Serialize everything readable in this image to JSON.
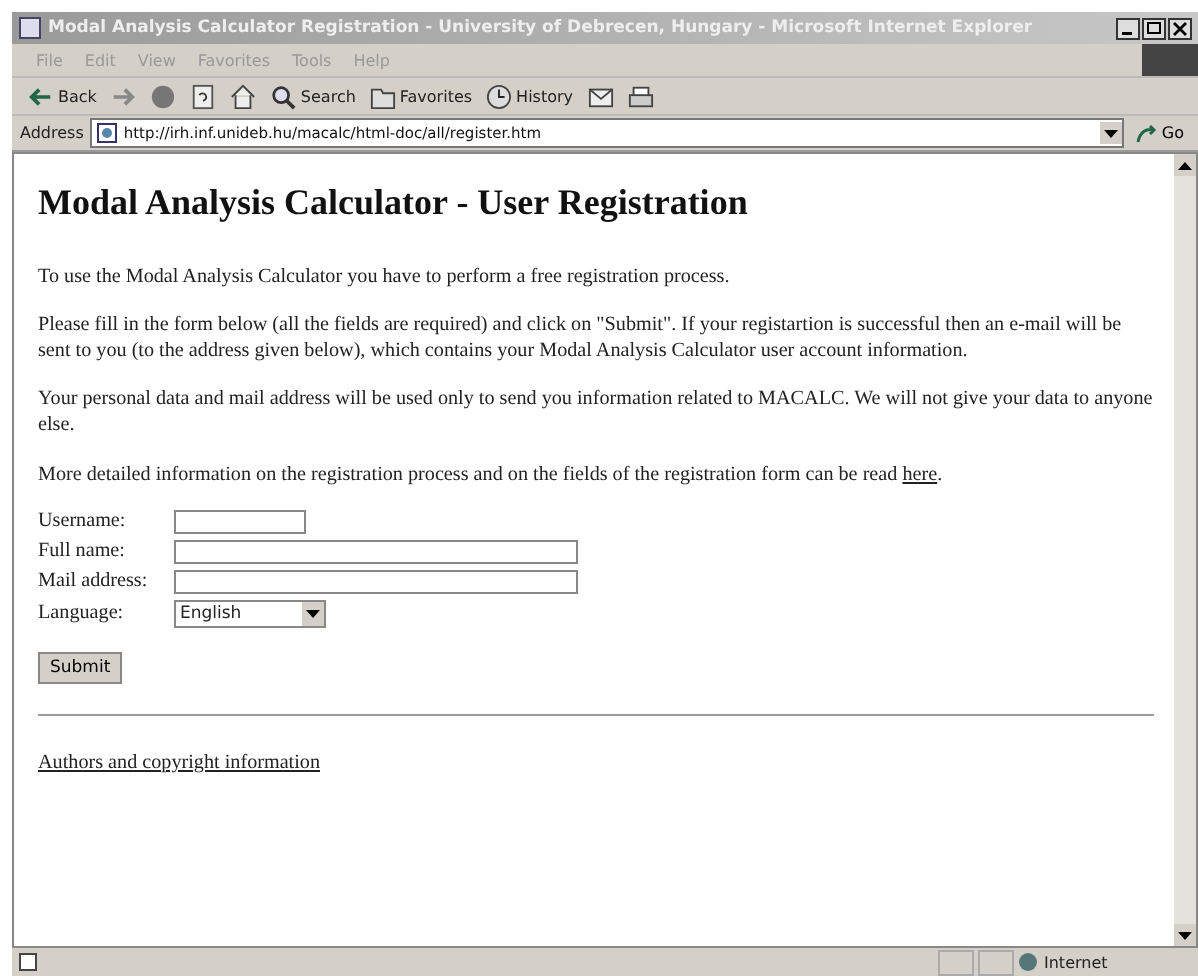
{
  "window": {
    "title": "Modal Analysis Calculator Registration - University of Debrecen, Hungary - Microsoft Internet Explorer"
  },
  "menu": [
    "File",
    "Edit",
    "View",
    "Favorites",
    "Tools",
    "Help"
  ],
  "toolbar": [
    {
      "kind": "back",
      "label": "Back"
    },
    {
      "kind": "forward"
    },
    {
      "kind": "stop"
    },
    {
      "kind": "refresh"
    },
    {
      "kind": "home"
    },
    {
      "kind": "search",
      "label": "Search"
    },
    {
      "kind": "favorites",
      "label": "Favorites"
    },
    {
      "kind": "history",
      "label": "History"
    },
    {
      "kind": "mail"
    },
    {
      "kind": "print"
    }
  ],
  "address": {
    "label": "Address",
    "value": "http://irh.inf.unideb.hu/macalc/html-doc/all/register.htm",
    "go": "Go"
  },
  "page": {
    "heading": "Modal Analysis Calculator - User Registration",
    "paragraphs": [
      "To use the Modal Analysis Calculator you have to perform a free registration process.",
      "Please fill in the form below (all the fields are required) and click on \"Submit\". If your registartion is successful then an e-mail will be sent to you (to the address given below), which contains your Modal Analysis Calculator user account information.",
      "Your personal data and mail address will be used only to send you information related to MACALC. We will not give your data to anyone else."
    ],
    "more_info": {
      "text": "More detailed information on the registration process and on the fields of the registration form can be read ",
      "link": "here",
      "after": "."
    },
    "form": [
      {
        "kind": "short",
        "label": "Username:"
      },
      {
        "kind": "long",
        "label": "Full name:"
      },
      {
        "kind": "long",
        "label": "Mail address:"
      },
      {
        "kind": "select",
        "label": "Language:",
        "value": "English"
      }
    ],
    "submit": "Submit",
    "footer_link": "Authors and copyright information"
  },
  "status_bar": {
    "zone": "Internet"
  }
}
